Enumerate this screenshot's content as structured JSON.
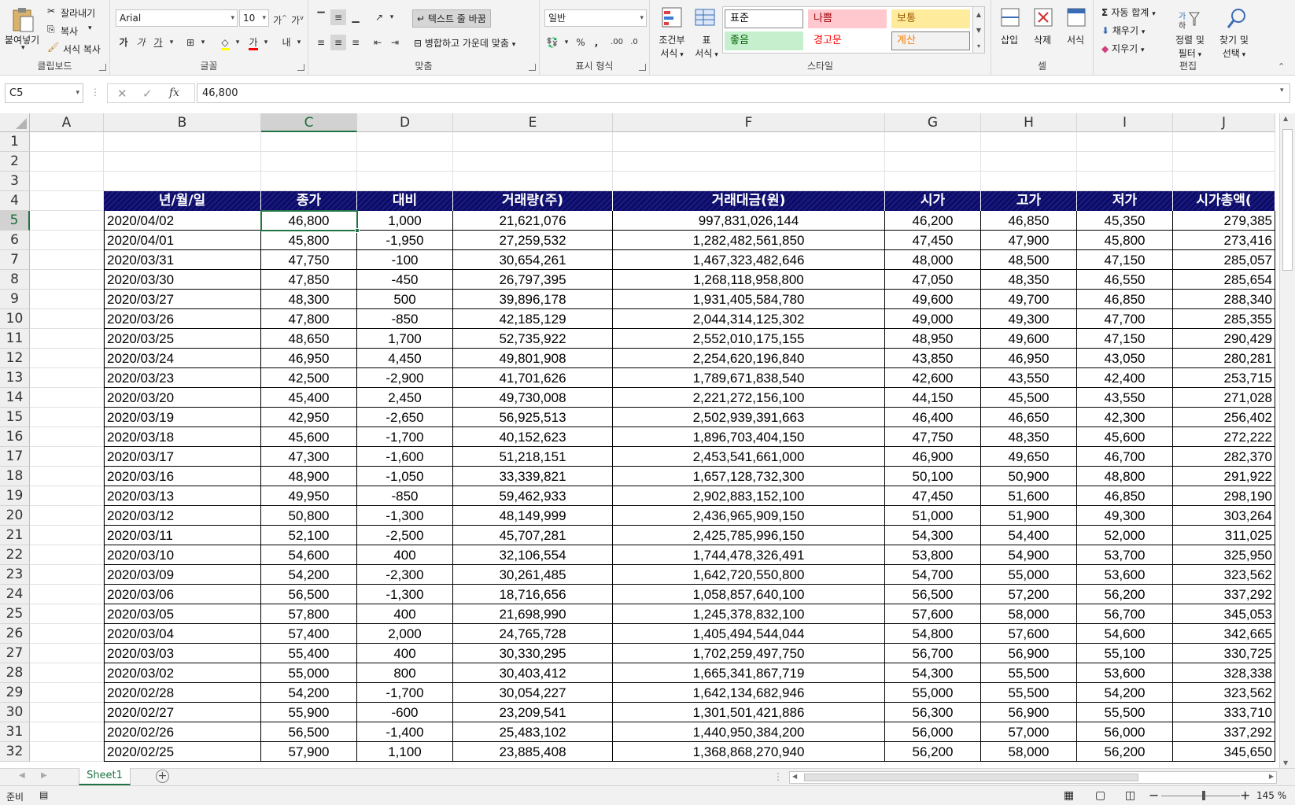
{
  "ribbon": {
    "clipboard": {
      "paste": "붙여넣기",
      "cut": "잘라내기",
      "copy": "복사",
      "format_painter": "서식 복사",
      "group": "클립보드"
    },
    "font": {
      "name": "Arial",
      "size": "10",
      "bold": "가",
      "italic": "가",
      "underline": "가",
      "group": "글꼴"
    },
    "alignment": {
      "wrap": "텍스트 줄 바꿈",
      "merge": "병합하고 가운데 맞춤",
      "group": "맞춤"
    },
    "number": {
      "format": "일반",
      "percent": "%",
      "comma": ",",
      "group": "표시 형식"
    },
    "styles": {
      "cond_format": [
        "조건부",
        "서식"
      ],
      "table_format": [
        "표",
        "서식"
      ],
      "items": [
        {
          "label": "표준",
          "bg": "#ffffff",
          "fg": "#000000",
          "border": "#8a8a8a"
        },
        {
          "label": "나쁨",
          "bg": "#ffc7ce",
          "fg": "#9c0006",
          "border": "#ffc7ce"
        },
        {
          "label": "보통",
          "bg": "#ffeb9c",
          "fg": "#9c5700",
          "border": "#ffeb9c"
        },
        {
          "label": "좋음",
          "bg": "#c6efce",
          "fg": "#006100",
          "border": "#c6efce"
        },
        {
          "label": "경고문",
          "bg": "#ffffff",
          "fg": "#ff0000",
          "border": "#ffffff"
        },
        {
          "label": "계산",
          "bg": "#f2f2f2",
          "fg": "#fa7d00",
          "border": "#7f7f7f"
        }
      ],
      "group": "스타일"
    },
    "cells": {
      "insert": "삽입",
      "delete": "삭제",
      "format": "서식",
      "group": "셀"
    },
    "editing": {
      "autosum": "자동 합계",
      "fill": "채우기",
      "clear": "지우기",
      "sort": [
        "정렬 및",
        "필터"
      ],
      "find": [
        "찾기 및",
        "선택"
      ],
      "group": "편집"
    }
  },
  "formula_bar": {
    "name_box": "C5",
    "fx": "fx",
    "content": "46,800"
  },
  "grid": {
    "columns": [
      "A",
      "B",
      "C",
      "D",
      "E",
      "F",
      "G",
      "H",
      "I",
      "J"
    ],
    "selected_column": "C",
    "selected_row": "5",
    "row_numbers": [
      "1",
      "2",
      "3",
      "4",
      "5",
      "6",
      "7",
      "8",
      "9",
      "10",
      "11",
      "12",
      "13",
      "14",
      "15",
      "16",
      "17",
      "18",
      "19",
      "20",
      "21",
      "22",
      "23",
      "24",
      "25",
      "26",
      "27",
      "28",
      "29",
      "30",
      "31",
      "32"
    ],
    "table_headers": [
      "년/월/일",
      "종가",
      "대비",
      "거래량(주)",
      "거래대금(원)",
      "시가",
      "고가",
      "저가",
      "시가총액("
    ],
    "rows": [
      [
        "2020/04/02",
        "46,800",
        "1,000",
        "21,621,076",
        "997,831,026,144",
        "46,200",
        "46,850",
        "45,350",
        "279,385"
      ],
      [
        "2020/04/01",
        "45,800",
        "-1,950",
        "27,259,532",
        "1,282,482,561,850",
        "47,450",
        "47,900",
        "45,800",
        "273,416"
      ],
      [
        "2020/03/31",
        "47,750",
        "-100",
        "30,654,261",
        "1,467,323,482,646",
        "48,000",
        "48,500",
        "47,150",
        "285,057"
      ],
      [
        "2020/03/30",
        "47,850",
        "-450",
        "26,797,395",
        "1,268,118,958,800",
        "47,050",
        "48,350",
        "46,550",
        "285,654"
      ],
      [
        "2020/03/27",
        "48,300",
        "500",
        "39,896,178",
        "1,931,405,584,780",
        "49,600",
        "49,700",
        "46,850",
        "288,340"
      ],
      [
        "2020/03/26",
        "47,800",
        "-850",
        "42,185,129",
        "2,044,314,125,302",
        "49,000",
        "49,300",
        "47,700",
        "285,355"
      ],
      [
        "2020/03/25",
        "48,650",
        "1,700",
        "52,735,922",
        "2,552,010,175,155",
        "48,950",
        "49,600",
        "47,150",
        "290,429"
      ],
      [
        "2020/03/24",
        "46,950",
        "4,450",
        "49,801,908",
        "2,254,620,196,840",
        "43,850",
        "46,950",
        "43,050",
        "280,281"
      ],
      [
        "2020/03/23",
        "42,500",
        "-2,900",
        "41,701,626",
        "1,789,671,838,540",
        "42,600",
        "43,550",
        "42,400",
        "253,715"
      ],
      [
        "2020/03/20",
        "45,400",
        "2,450",
        "49,730,008",
        "2,221,272,156,100",
        "44,150",
        "45,500",
        "43,550",
        "271,028"
      ],
      [
        "2020/03/19",
        "42,950",
        "-2,650",
        "56,925,513",
        "2,502,939,391,663",
        "46,400",
        "46,650",
        "42,300",
        "256,402"
      ],
      [
        "2020/03/18",
        "45,600",
        "-1,700",
        "40,152,623",
        "1,896,703,404,150",
        "47,750",
        "48,350",
        "45,600",
        "272,222"
      ],
      [
        "2020/03/17",
        "47,300",
        "-1,600",
        "51,218,151",
        "2,453,541,661,000",
        "46,900",
        "49,650",
        "46,700",
        "282,370"
      ],
      [
        "2020/03/16",
        "48,900",
        "-1,050",
        "33,339,821",
        "1,657,128,732,300",
        "50,100",
        "50,900",
        "48,800",
        "291,922"
      ],
      [
        "2020/03/13",
        "49,950",
        "-850",
        "59,462,933",
        "2,902,883,152,100",
        "47,450",
        "51,600",
        "46,850",
        "298,190"
      ],
      [
        "2020/03/12",
        "50,800",
        "-1,300",
        "48,149,999",
        "2,436,965,909,150",
        "51,000",
        "51,900",
        "49,300",
        "303,264"
      ],
      [
        "2020/03/11",
        "52,100",
        "-2,500",
        "45,707,281",
        "2,425,785,996,150",
        "54,300",
        "54,400",
        "52,000",
        "311,025"
      ],
      [
        "2020/03/10",
        "54,600",
        "400",
        "32,106,554",
        "1,744,478,326,491",
        "53,800",
        "54,900",
        "53,700",
        "325,950"
      ],
      [
        "2020/03/09",
        "54,200",
        "-2,300",
        "30,261,485",
        "1,642,720,550,800",
        "54,700",
        "55,000",
        "53,600",
        "323,562"
      ],
      [
        "2020/03/06",
        "56,500",
        "-1,300",
        "18,716,656",
        "1,058,857,640,100",
        "56,500",
        "57,200",
        "56,200",
        "337,292"
      ],
      [
        "2020/03/05",
        "57,800",
        "400",
        "21,698,990",
        "1,245,378,832,100",
        "57,600",
        "58,000",
        "56,700",
        "345,053"
      ],
      [
        "2020/03/04",
        "57,400",
        "2,000",
        "24,765,728",
        "1,405,494,544,044",
        "54,800",
        "57,600",
        "54,600",
        "342,665"
      ],
      [
        "2020/03/03",
        "55,400",
        "400",
        "30,330,295",
        "1,702,259,497,750",
        "56,700",
        "56,900",
        "55,100",
        "330,725"
      ],
      [
        "2020/03/02",
        "55,000",
        "800",
        "30,403,412",
        "1,665,341,867,719",
        "54,300",
        "55,500",
        "53,600",
        "328,338"
      ],
      [
        "2020/02/28",
        "54,200",
        "-1,700",
        "30,054,227",
        "1,642,134,682,946",
        "55,000",
        "55,500",
        "54,200",
        "323,562"
      ],
      [
        "2020/02/27",
        "55,900",
        "-600",
        "23,209,541",
        "1,301,501,421,886",
        "56,300",
        "56,900",
        "55,500",
        "333,710"
      ],
      [
        "2020/02/26",
        "56,500",
        "-1,400",
        "25,483,102",
        "1,440,950,384,200",
        "56,000",
        "57,000",
        "56,000",
        "337,292"
      ],
      [
        "2020/02/25",
        "57,900",
        "1,100",
        "23,885,408",
        "1,368,868,270,940",
        "56,200",
        "58,000",
        "56,200",
        "345,650"
      ]
    ]
  },
  "sheet_tabs": {
    "active": "Sheet1",
    "add": "+"
  },
  "status_bar": {
    "ready": "준비",
    "zoom": "145 %"
  }
}
